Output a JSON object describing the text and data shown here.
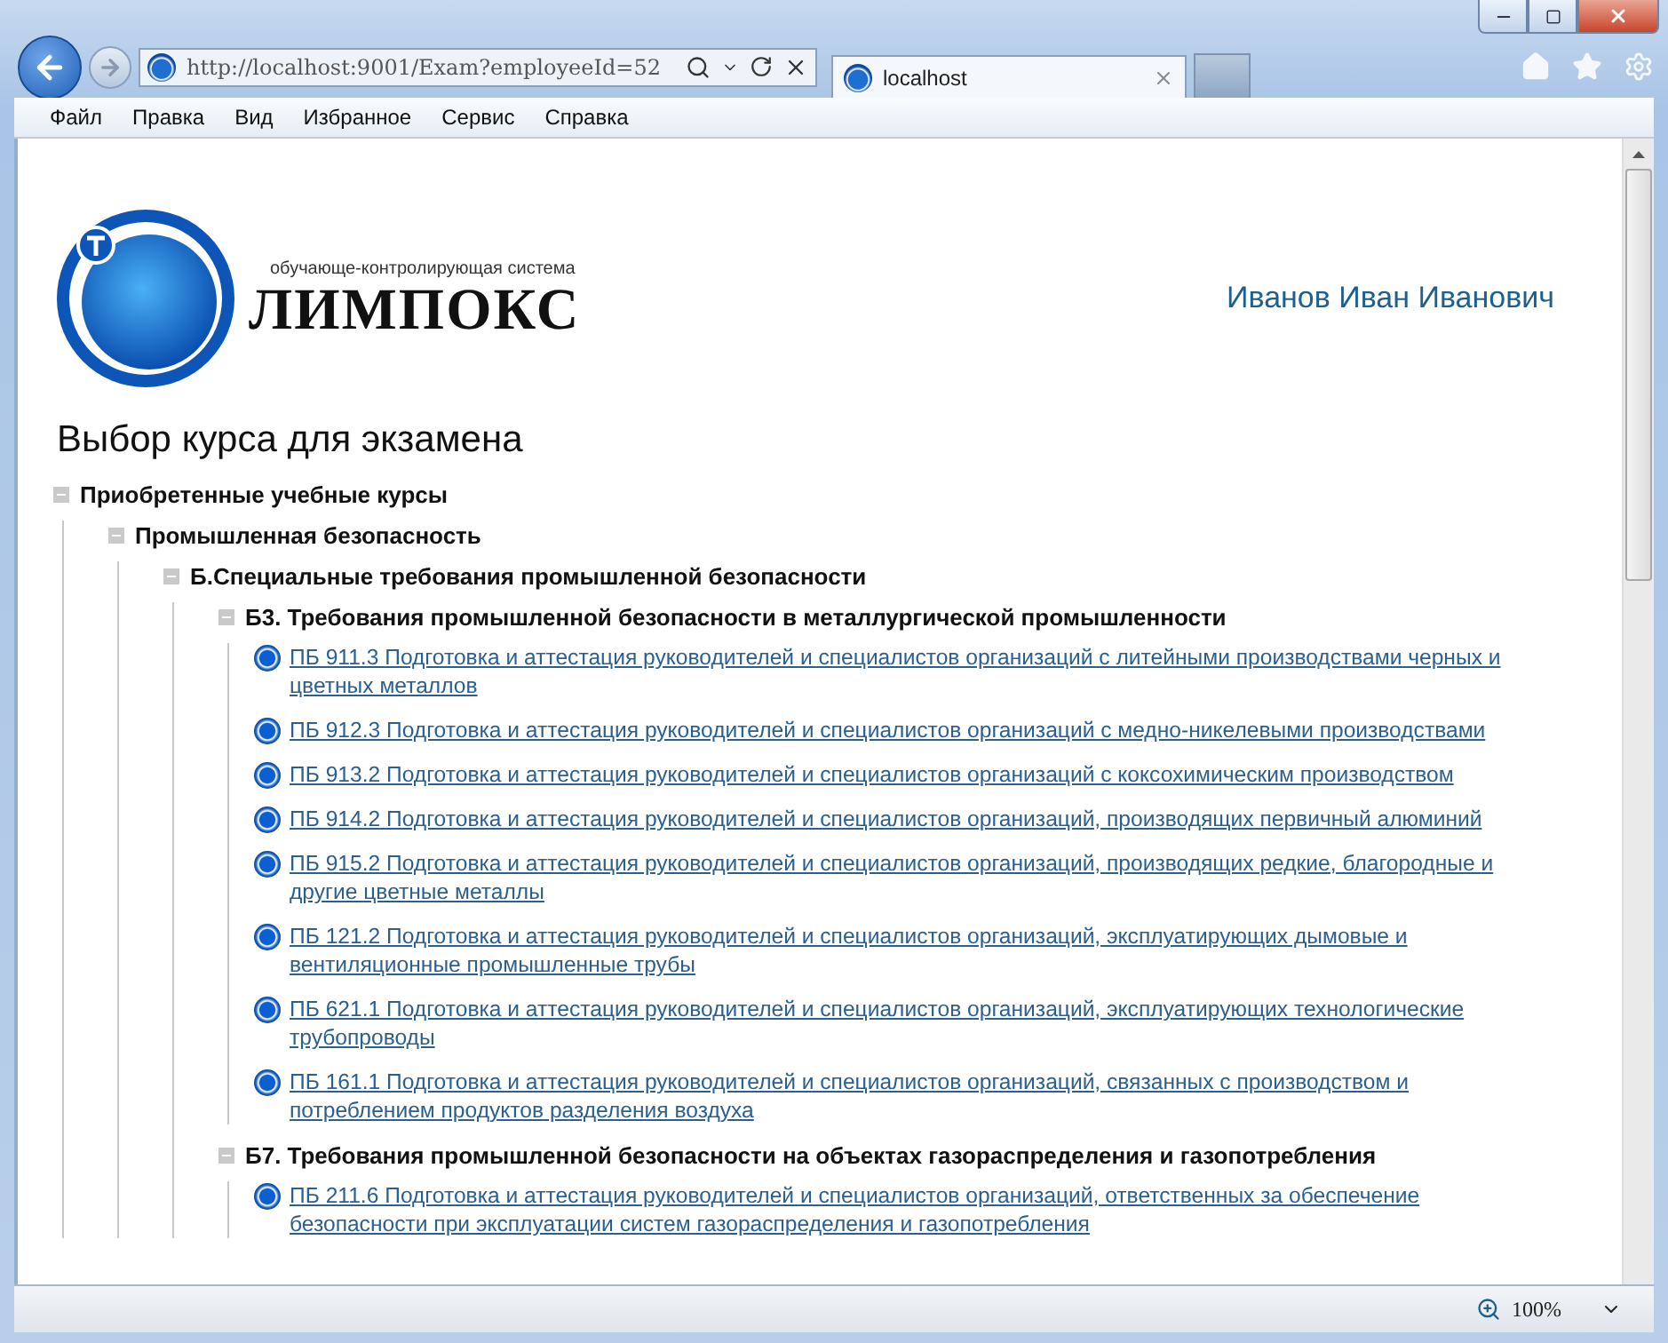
{
  "browser": {
    "address": "http://localhost:9001/Exam?employeeId=52",
    "tabs": [
      {
        "label": "localhost",
        "selected": true
      }
    ],
    "menu": [
      "Файл",
      "Правка",
      "Вид",
      "Избранное",
      "Сервис",
      "Справка"
    ],
    "zoom": "100%"
  },
  "logo": {
    "tagline": "обучающе-контролирующая система",
    "name": "ЛИМПОКС"
  },
  "user": "Иванов Иван Иванович",
  "heading": "Выбор курса для экзамена",
  "tree": [
    {
      "kind": "group",
      "label": "Приобретенные учебные курсы",
      "expanded": true,
      "children": [
        {
          "kind": "group",
          "label": "Промышленная безопасность",
          "expanded": true,
          "children": [
            {
              "kind": "group",
              "label": "Б.Специальные требования промышленной безопасности",
              "expanded": true,
              "children": [
                {
                  "kind": "group",
                  "label": "Б3. Требования промышленной безопасности в металлургической промышленности",
                  "expanded": true,
                  "children": [
                    {
                      "kind": "course",
                      "label": "ПБ 911.3 Подготовка и аттестация руководителей и специалистов организаций с литейными производствами черных и цветных металлов"
                    },
                    {
                      "kind": "course",
                      "label": "ПБ 912.3 Подготовка и аттестация руководителей и специалистов организаций с медно-никелевыми производствами"
                    },
                    {
                      "kind": "course",
                      "label": "ПБ 913.2 Подготовка и аттестация руководителей и специалистов организаций с коксохимическим производством"
                    },
                    {
                      "kind": "course",
                      "label": "ПБ 914.2 Подготовка и аттестация руководителей и специалистов организаций, производящих первичный алюминий"
                    },
                    {
                      "kind": "course",
                      "label": "ПБ 915.2 Подготовка и аттестация руководителей и специалистов организаций, производящих редкие, благородные и другие цветные металлы"
                    },
                    {
                      "kind": "course",
                      "label": "ПБ 121.2 Подготовка и аттестация руководителей и специалистов организаций, эксплуатирующих дымовые и вентиляционные промышленные трубы"
                    },
                    {
                      "kind": "course",
                      "label": "ПБ 621.1 Подготовка и аттестация руководителей и специалистов организаций, эксплуатирующих технологические трубопроводы"
                    },
                    {
                      "kind": "course",
                      "label": "ПБ 161.1 Подготовка и аттестация руководителей и специалистов организаций, связанных с производством и потреблением продуктов разделения воздуха"
                    }
                  ]
                },
                {
                  "kind": "group",
                  "label": "Б7. Требования промышленной безопасности на объектах газораспределения и газопотребления",
                  "expanded": true,
                  "children": [
                    {
                      "kind": "course",
                      "label": "ПБ 211.6 Подготовка и аттестация руководителей и специалистов организаций, ответственных за обеспечение безопасности при эксплуатации систем газораспределения и газопотребления"
                    }
                  ]
                }
              ]
            }
          ]
        }
      ]
    }
  ]
}
